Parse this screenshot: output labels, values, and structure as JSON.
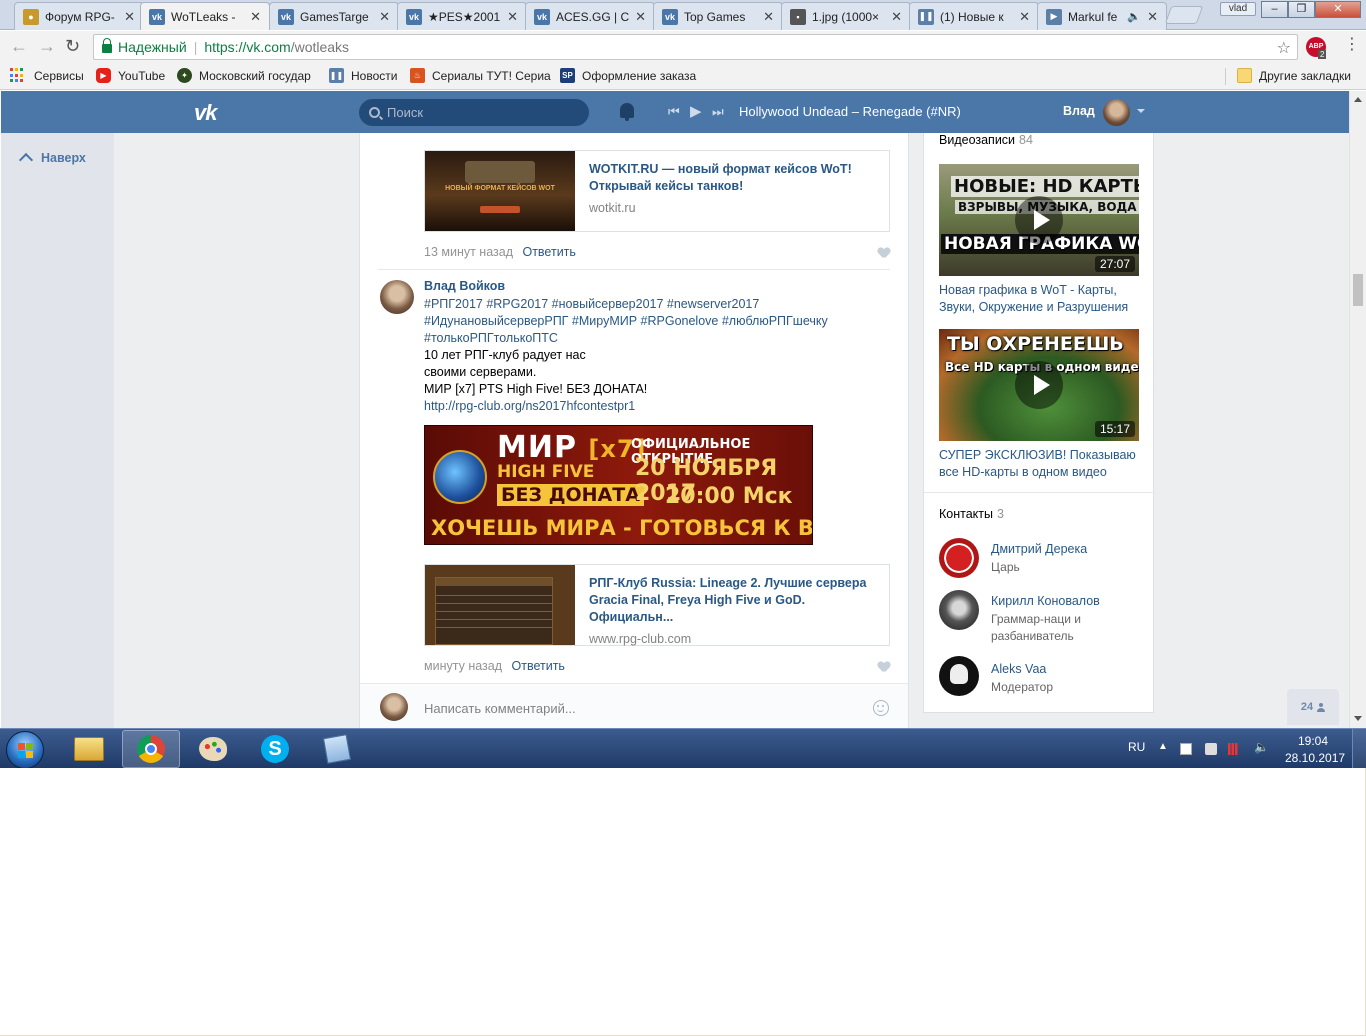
{
  "browser": {
    "tabs": [
      {
        "title": "Форум RPG-",
        "favicon_color": "#c79a2c",
        "active": false
      },
      {
        "title": "WoTLeaks - ",
        "favicon_color": "#4a76a8",
        "active": true
      },
      {
        "title": "GamesTarge",
        "favicon_color": "#4a76a8",
        "active": false
      },
      {
        "title": "★PES★2001",
        "favicon_color": "#4a76a8",
        "active": false
      },
      {
        "title": "ACES.GG | C",
        "favicon_color": "#4a76a8",
        "active": false
      },
      {
        "title": "Top Games",
        "favicon_color": "#4a76a8",
        "active": false
      },
      {
        "title": "1.jpg (1000×",
        "favicon_color": "#555555",
        "active": false
      },
      {
        "title": "(1) Новые к",
        "favicon_color": "#5c7fa8",
        "active": false
      },
      {
        "title": "Markul fe",
        "favicon_color": "#5c7fa8",
        "active": false
      }
    ],
    "user_chip": "vlad",
    "secure_label": "Надежный",
    "url_base": "https://vk.com",
    "url_path": "/wotleaks",
    "abp_label": "ABP",
    "abp_count": "2",
    "bookmarks": [
      {
        "label": "Сервисы",
        "icon": "apps-grid-icon"
      },
      {
        "label": "YouTube",
        "icon": "youtube-icon",
        "color": "#e62117"
      },
      {
        "label": "Московский государ",
        "icon": "emblem-icon",
        "color": "#2c4a1e"
      },
      {
        "label": "Новости",
        "icon": "pause-news-icon",
        "color": "#5c7fa8"
      },
      {
        "label": "Сериалы ТУТ! Сериа",
        "icon": "flame-icon",
        "color": "#d9531e"
      },
      {
        "label": "Оформление заказа",
        "icon": "sp-icon",
        "color": "#1c3f7a"
      }
    ],
    "other_bookmarks": "Другие закладки"
  },
  "vk": {
    "search_placeholder": "Поиск",
    "track": "Hollywood Undead – Renegade (#NR)",
    "me_name": "Влад",
    "back_to_top": "Наверх",
    "posts": [
      {
        "snippet_title": "WOTKIT.RU — новый формат кейсов WoT! Открывай кейсы танков!",
        "snippet_domain": "wotkit.ru",
        "snippet_thumb_text": "НОВЫЙ ФОРМАТ КЕЙСОВ WOT",
        "time": "13 минут назад",
        "reply": "Ответить"
      },
      {
        "author": "Влад Войков",
        "tags": "#РПГ2017 #RPG2017 #новыйсервер2017 #newserver2017 #ИдунановыйсерверРПГ #МируМИР #RPGonelove #люблюРПГшечку #толькоРПГтолькоПТС",
        "text_lines": [
          "10 лет РПГ-клуб радует нас",
          "своими серверами.",
          "МИР [x7] PTS High Five! БЕЗ ДОНАТА!"
        ],
        "link": "http://rpg-club.org/ns2017hfcontestpr1",
        "banner": {
          "line1": "МИР",
          "line1_accent": "[x7]",
          "line2": "HIGH FIVE",
          "line3": "БЕЗ ДОНАТА",
          "line4": "ОФИЦИАЛЬНОЕ ОТКРЫТИЕ",
          "line5": "20 НОЯБРЯ 2017",
          "line6": "20:00 Мск",
          "line7": "ХОЧЕШЬ МИРА - ГОТОВЬСЯ К ВОЙНЕ"
        },
        "snippet_title": "РПГ-Клуб Russia: Lineage 2. Лучшие сервера Gracia Final, Freya High Five и GoD. Официальн...",
        "snippet_domain": "www.rpg-club.com",
        "time": "минуту назад",
        "reply": "Ответить"
      }
    ],
    "comment_placeholder": "Написать комментарий...",
    "videos": {
      "title": "Видеозаписи",
      "count": "84",
      "items": [
        {
          "thumb_top": "НОВЫЕ: HD КАРТЫ",
          "thumb_mid": "ВЗРЫВЫ, МУЗЫКА, ВОДА",
          "thumb_bottom": "НОВАЯ ГРАФИКА WOT",
          "duration": "27:07",
          "caption": "Новая графика в WoT - Карты, Звуки, Окружение и Разрушения"
        },
        {
          "thumb_top": "ТЫ ОХРЕНЕЕШЬ",
          "thumb_mid": "Все HD карты в одном видео",
          "thumb_bottom": "",
          "duration": "15:17",
          "caption": "СУПЕР ЭКСКЛЮЗИВ! Показываю все HD-карты в одном видео"
        }
      ]
    },
    "contacts": {
      "title": "Контакты",
      "count": "3",
      "items": [
        {
          "name": "Дмитрий Дерека",
          "role": "Царь",
          "avatar_color": "#b01616"
        },
        {
          "name": "Кирилл Коновалов",
          "role": "Граммар-наци и разбаниватель",
          "avatar_color": "#2b2b2b"
        },
        {
          "name": "Aleks Vaa",
          "role": "Модератор",
          "avatar_color": "#111111"
        }
      ]
    },
    "online_count": "24"
  },
  "taskbar": {
    "lang": "RU",
    "time": "19:04",
    "date": "28.10.2017"
  }
}
